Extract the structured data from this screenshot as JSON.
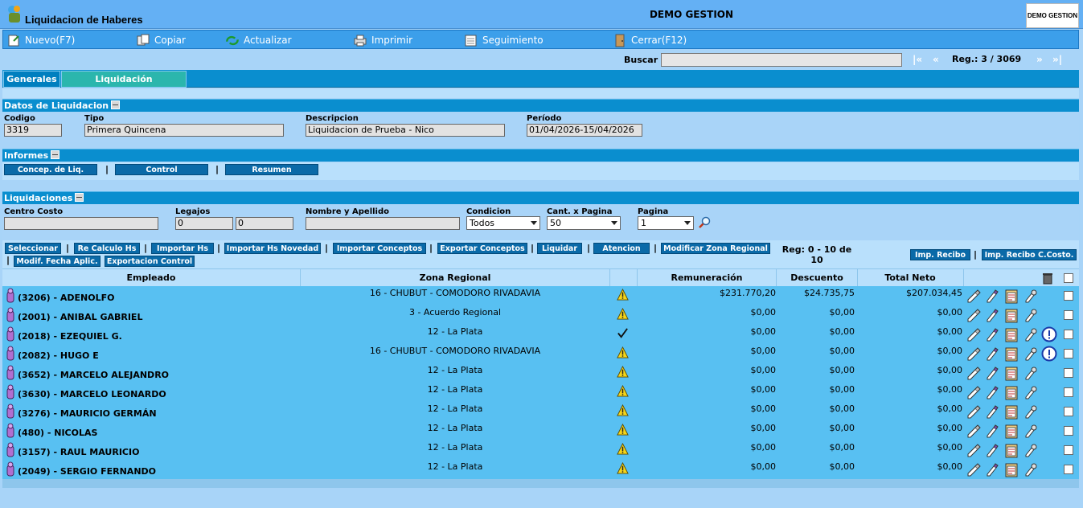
{
  "window": {
    "title": "Liquidacion de Haberes",
    "company": "DEMO GESTION",
    "logo_text": "DEMO GESTION"
  },
  "toolbar": {
    "nuevo": "Nuevo(F7)",
    "copiar": "Copiar",
    "actualizar": "Actualizar",
    "imprimir": "Imprimir",
    "seguimiento": "Seguimiento",
    "cerrar": "Cerrar(F12)"
  },
  "search": {
    "label": "Buscar",
    "value": "",
    "first": "|«",
    "prev": "«",
    "next": "»",
    "last": "»|",
    "reg": "Reg.: 3 / 3069"
  },
  "tabs": {
    "generales": "Generales",
    "liquidacion": "Liquidación"
  },
  "datos": {
    "title": "Datos de Liquidacion",
    "codigo_label": "Codigo",
    "codigo": "3319",
    "tipo_label": "Tipo",
    "tipo": "Primera Quincena",
    "descripcion_label": "Descripcion",
    "descripcion": "Liquidacion de Prueba - Nico",
    "periodo_label": "Período",
    "periodo": "01/04/2026-15/04/2026"
  },
  "informes": {
    "title": "Informes",
    "concep": "Concep. de Liq.",
    "control": "Control",
    "resumen": "Resumen"
  },
  "liquidaciones": {
    "title": "Liquidaciones",
    "centro_label": "Centro Costo",
    "centro": "",
    "legajos_label": "Legajos",
    "legajo_desde": "0",
    "legajo_hasta": "0",
    "nombre_label": "Nombre y Apellido",
    "nombre": "",
    "condicion_label": "Condicion",
    "condicion": "Todos",
    "cant_label": "Cant. x Pagina",
    "cant": "50",
    "pagina_label": "Pagina",
    "pagina": "1"
  },
  "actions": {
    "seleccionar": "Seleccionar",
    "recalculo": "Re Calculo Hs",
    "importar_hs": "Importar Hs",
    "importar_novedad": "Importar Hs Novedad",
    "importar_conceptos": "Importar Conceptos",
    "exportar_conceptos": "Exportar Conceptos",
    "liquidar": "Liquidar",
    "atencion": "Atencion",
    "modificar_zona": "Modificar Zona Regional",
    "modif_fecha": "Modif. Fecha Aplic.",
    "exportacion_control": "Exportacion Control",
    "reg_count": "Reg: 0 - 10 de 10",
    "imp_recibo": "Imp. Recibo",
    "imp_recibo_cc": "Imp. Recibo C.Costo."
  },
  "grid": {
    "headers": {
      "empleado": "Empleado",
      "zona": "Zona Regional",
      "remuneracion": "Remuneración",
      "descuento": "Descuento",
      "total": "Total Neto"
    },
    "rows": [
      {
        "empleado": "(3206) - ADENOLFO",
        "zona": "16 - CHUBUT - COMODORO RIVADAVIA",
        "status": "warning",
        "remuneracion": "$231.770,20",
        "descuento": "$24.735,75",
        "total": "$207.034,45",
        "alert": false
      },
      {
        "empleado": "(2001) - ANIBAL GABRIEL",
        "zona": "3 - Acuerdo Regional",
        "status": "warning",
        "remuneracion": "$0,00",
        "descuento": "$0,00",
        "total": "$0,00",
        "alert": false
      },
      {
        "empleado": "(2018) - EZEQUIEL G.",
        "zona": "12 - La Plata",
        "status": "check",
        "remuneracion": "$0,00",
        "descuento": "$0,00",
        "total": "$0,00",
        "alert": true
      },
      {
        "empleado": "(2082) - HUGO E",
        "zona": "16 - CHUBUT - COMODORO RIVADAVIA",
        "status": "warning",
        "remuneracion": "$0,00",
        "descuento": "$0,00",
        "total": "$0,00",
        "alert": true
      },
      {
        "empleado": "(3652) - MARCELO ALEJANDRO",
        "zona": "12 - La Plata",
        "status": "warning",
        "remuneracion": "$0,00",
        "descuento": "$0,00",
        "total": "$0,00",
        "alert": false
      },
      {
        "empleado": "(3630) - MARCELO LEONARDO",
        "zona": "12 - La Plata",
        "status": "warning",
        "remuneracion": "$0,00",
        "descuento": "$0,00",
        "total": "$0,00",
        "alert": false
      },
      {
        "empleado": "(3276) - MAURICIO GERMÁN",
        "zona": "12 - La Plata",
        "status": "warning",
        "remuneracion": "$0,00",
        "descuento": "$0,00",
        "total": "$0,00",
        "alert": false
      },
      {
        "empleado": "(480) - NICOLAS",
        "zona": "12 - La Plata",
        "status": "warning",
        "remuneracion": "$0,00",
        "descuento": "$0,00",
        "total": "$0,00",
        "alert": false
      },
      {
        "empleado": "(3157) - RAUL MAURICIO",
        "zona": "12 - La Plata",
        "status": "warning",
        "remuneracion": "$0,00",
        "descuento": "$0,00",
        "total": "$0,00",
        "alert": false
      },
      {
        "empleado": "(2049) - SERGIO FERNANDO",
        "zona": "12 - La Plata",
        "status": "warning",
        "remuneracion": "$0,00",
        "descuento": "$0,00",
        "total": "$0,00",
        "alert": false
      }
    ]
  }
}
